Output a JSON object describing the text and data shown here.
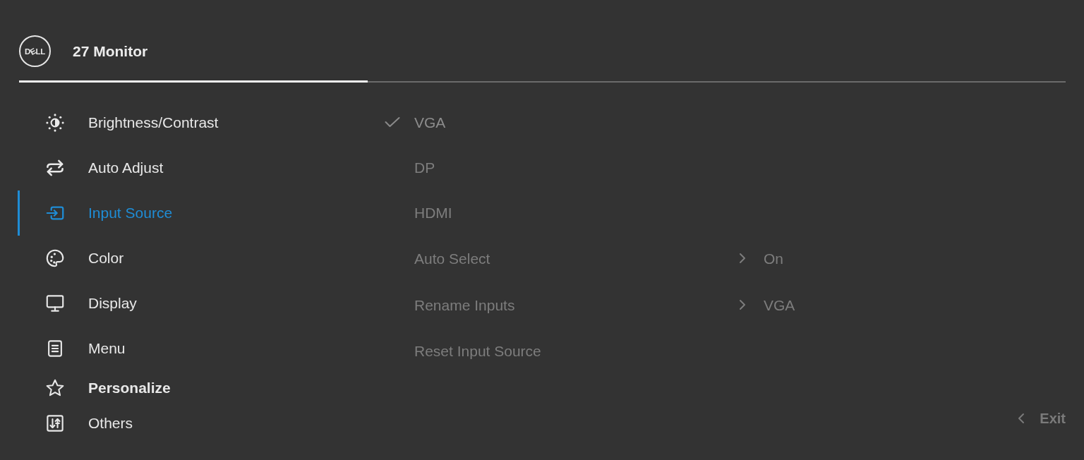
{
  "header": {
    "logo": "DELL",
    "title": "27 Monitor"
  },
  "menu": {
    "items": [
      {
        "label": "Brightness/Contrast",
        "kind": "plain",
        "selected": false
      },
      {
        "label": "Auto Adjust",
        "kind": "plain",
        "selected": false
      },
      {
        "label": "Input Source",
        "kind": "plain",
        "selected": true
      },
      {
        "label": "Color",
        "kind": "plain",
        "selected": false
      },
      {
        "label": "Display",
        "kind": "plain",
        "selected": false
      },
      {
        "label": "Menu",
        "kind": "plain",
        "selected": false
      },
      {
        "label": "Personalize",
        "kind": "emphasized",
        "selected": false
      },
      {
        "label": "Others",
        "kind": "plain",
        "selected": false
      }
    ]
  },
  "options": {
    "items": [
      {
        "kind": "choice",
        "label": "VGA",
        "selected": true
      },
      {
        "kind": "choice",
        "label": "DP",
        "selected": false
      },
      {
        "kind": "choice",
        "label": "HDMI",
        "selected": false
      },
      {
        "kind": "submenu",
        "label": "Auto Select",
        "value": "On"
      },
      {
        "kind": "submenu",
        "label": "Rename Inputs",
        "value": "VGA"
      },
      {
        "kind": "action",
        "label": "Reset Input Source"
      }
    ]
  },
  "footer": {
    "exit": "Exit"
  }
}
